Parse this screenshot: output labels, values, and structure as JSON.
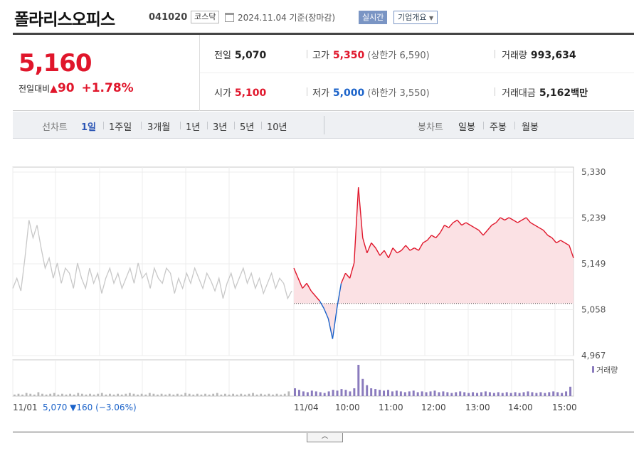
{
  "header": {
    "name": "폴라리스오피스",
    "code": "041020",
    "market": "코스닥",
    "date": "2024.11.04 기준(장마감)",
    "realtime": "실시간",
    "company_info": "기업개요"
  },
  "quote": {
    "price": "5,160",
    "change_label": "전일대비",
    "change": "90",
    "change_pct": "+1.78%",
    "prev_close_label": "전일",
    "prev_close": "5,070",
    "high_label": "고가",
    "high": "5,350",
    "upper_limit": "(상한가 6,590)",
    "volume_label": "거래량",
    "volume": "993,634",
    "open_label": "시가",
    "open": "5,100",
    "low_label": "저가",
    "low": "5,000",
    "lower_limit": "(하한가 3,550)",
    "amount_label": "거래대금",
    "amount": "5,162",
    "amount_unit": "백만"
  },
  "tabs": {
    "line_label": "선차트",
    "line_periods": [
      "1일",
      "1주일",
      "3개월",
      "1년",
      "3년",
      "5년",
      "10년"
    ],
    "line_active": 0,
    "candle_label": "봉차트",
    "candle_periods": [
      "일봉",
      "주봉",
      "월봉"
    ]
  },
  "colors": {
    "up": "#e0162b",
    "down": "#1a62c9",
    "prev_day": "#c8c8c8",
    "volume": "#8a7bbd",
    "area": "#fbe1e4"
  },
  "chart_data": {
    "type": "line",
    "y_ticks": [
      "5,330",
      "5,239",
      "5,149",
      "5,058",
      "4,967"
    ],
    "ylim": [
      4967,
      5330
    ],
    "baseline": 5070,
    "x_ticks": [
      "11/01",
      "11/04",
      "10:00",
      "11:00",
      "12:00",
      "13:00",
      "14:00",
      "15:00"
    ],
    "prev_day_note": {
      "date": "11/01",
      "close": "5,070",
      "change": "▼160",
      "change_pct": "(−3.06%)"
    },
    "volume_legend": "거래량",
    "prev_day_series": [
      5100,
      5120,
      5095,
      5160,
      5235,
      5200,
      5225,
      5180,
      5140,
      5160,
      5120,
      5150,
      5110,
      5140,
      5130,
      5100,
      5150,
      5120,
      5100,
      5140,
      5110,
      5130,
      5090,
      5120,
      5140,
      5110,
      5130,
      5100,
      5120,
      5140,
      5110,
      5150,
      5120,
      5130,
      5100,
      5140,
      5120,
      5110,
      5140,
      5130,
      5090,
      5120,
      5100,
      5130,
      5110,
      5140,
      5120,
      5100,
      5130,
      5115,
      5095,
      5120,
      5080,
      5110,
      5130,
      5100,
      5120,
      5140,
      5110,
      5130,
      5100,
      5120,
      5090,
      5110,
      5130,
      5100,
      5120,
      5110,
      5080,
      5095
    ],
    "today_series": [
      5140,
      5120,
      5100,
      5110,
      5095,
      5085,
      5075,
      5060,
      5040,
      5000,
      5060,
      5110,
      5130,
      5120,
      5150,
      5300,
      5200,
      5170,
      5190,
      5180,
      5165,
      5175,
      5160,
      5180,
      5170,
      5175,
      5185,
      5175,
      5180,
      5175,
      5190,
      5195,
      5205,
      5200,
      5210,
      5225,
      5220,
      5230,
      5235,
      5225,
      5230,
      5225,
      5220,
      5215,
      5205,
      5215,
      5225,
      5230,
      5240,
      5235,
      5240,
      5235,
      5230,
      5235,
      5240,
      5230,
      5225,
      5220,
      5215,
      5205,
      5200,
      5190,
      5195,
      5190,
      5185,
      5160
    ],
    "prev_volume": [
      2,
      3,
      2,
      4,
      3,
      2,
      5,
      3,
      2,
      3,
      4,
      2,
      3,
      2,
      3,
      2,
      4,
      3,
      2,
      3,
      2,
      3,
      4,
      2,
      3,
      2,
      3,
      2,
      3,
      4,
      3,
      2,
      3,
      2,
      4,
      3,
      2,
      3,
      2,
      3,
      2,
      3,
      2,
      4,
      3,
      2,
      3,
      2,
      3,
      2,
      3,
      4,
      2,
      3,
      2,
      3,
      2,
      3,
      2,
      3,
      4,
      2,
      3,
      2,
      3,
      2,
      3,
      2,
      3,
      6
    ],
    "today_volume": [
      10,
      8,
      6,
      5,
      7,
      6,
      5,
      4,
      6,
      8,
      7,
      9,
      8,
      6,
      10,
      40,
      22,
      14,
      10,
      9,
      8,
      7,
      8,
      6,
      7,
      6,
      5,
      6,
      7,
      5,
      6,
      5,
      6,
      7,
      5,
      6,
      5,
      4,
      5,
      6,
      5,
      4,
      5,
      4,
      5,
      6,
      5,
      4,
      5,
      4,
      5,
      4,
      5,
      4,
      5,
      6,
      5,
      4,
      5,
      4,
      5,
      6,
      5,
      4,
      6,
      12
    ]
  }
}
